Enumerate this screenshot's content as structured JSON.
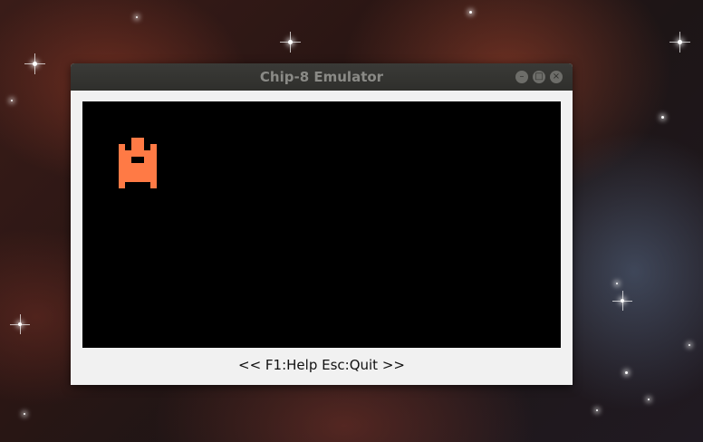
{
  "window": {
    "title": "Chip-8 Emulator",
    "controls": {
      "minimize_glyph": "–",
      "maximize_glyph": "□",
      "close_glyph": "×"
    }
  },
  "display": {
    "background_color": "#000000",
    "pixel_color": "#ff7a45",
    "sprite_icon": "space-invader-tank-sprite"
  },
  "status_bar": {
    "text": "<< F1:Help Esc:Quit >>"
  }
}
